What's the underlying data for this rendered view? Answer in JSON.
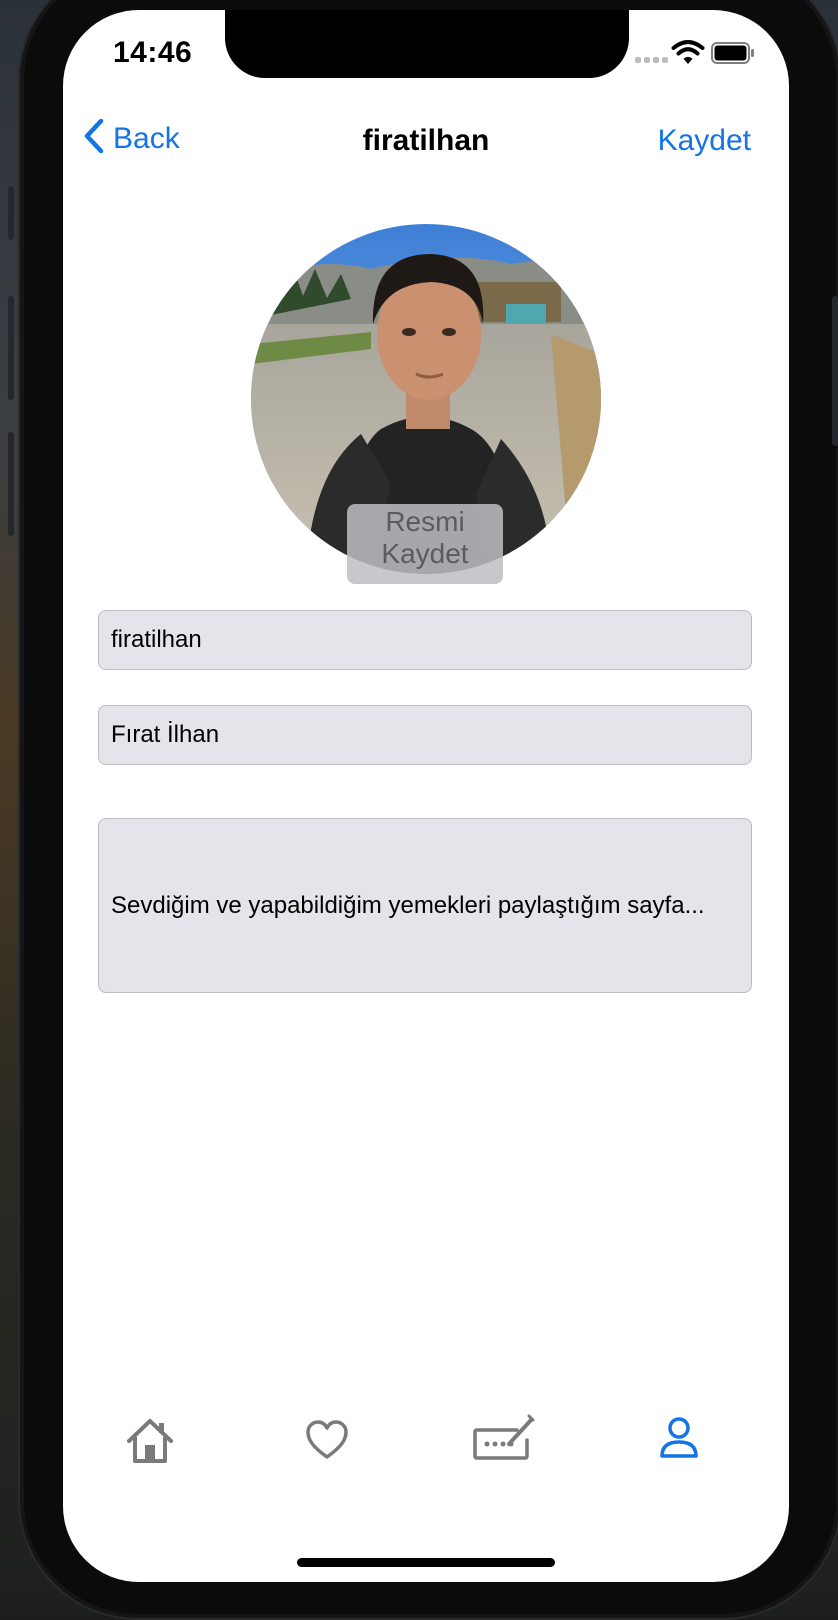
{
  "status_bar": {
    "time": "14:46"
  },
  "nav": {
    "back_label": "Back",
    "title": "firatilhan",
    "save_label": "Kaydet"
  },
  "profile": {
    "save_photo_label": "Resmi Kaydet"
  },
  "form": {
    "username": "firatilhan",
    "full_name": "Fırat İlhan",
    "bio": "Sevdiğim ve yapabildiğim yemekleri paylaştığım sayfa..."
  },
  "tabbar": {
    "items": [
      {
        "icon": "home-icon",
        "selected": false
      },
      {
        "icon": "heart-icon",
        "selected": false
      },
      {
        "icon": "keyboard-edit-icon",
        "selected": false
      },
      {
        "icon": "person-icon",
        "selected": true
      }
    ]
  },
  "colors": {
    "accent": "#1473e6",
    "field_bg": "#e4e4ea",
    "tab_inactive": "#7a7a7a"
  }
}
